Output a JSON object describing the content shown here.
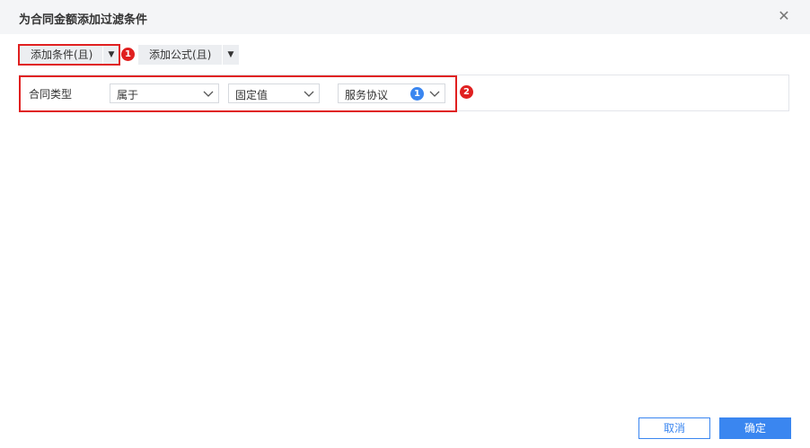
{
  "dialog": {
    "title": "为合同金额添加过滤条件",
    "close_icon": "close-icon"
  },
  "toolbar": {
    "add_condition_label": "添加条件(且)",
    "add_formula_label": "添加公式(且)",
    "dropdown_icon": "caret-down-icon"
  },
  "markers": {
    "first": "1",
    "second": "2"
  },
  "condition": {
    "field_label": "合同类型",
    "operator": "属于",
    "value_type": "固定值",
    "value": "服务协议",
    "selected_count": "1"
  },
  "footer": {
    "cancel_label": "取消",
    "ok_label": "确定"
  },
  "colors": {
    "accent": "#3a86f0",
    "highlight": "#e02020",
    "header_bg": "#f4f5f7"
  }
}
